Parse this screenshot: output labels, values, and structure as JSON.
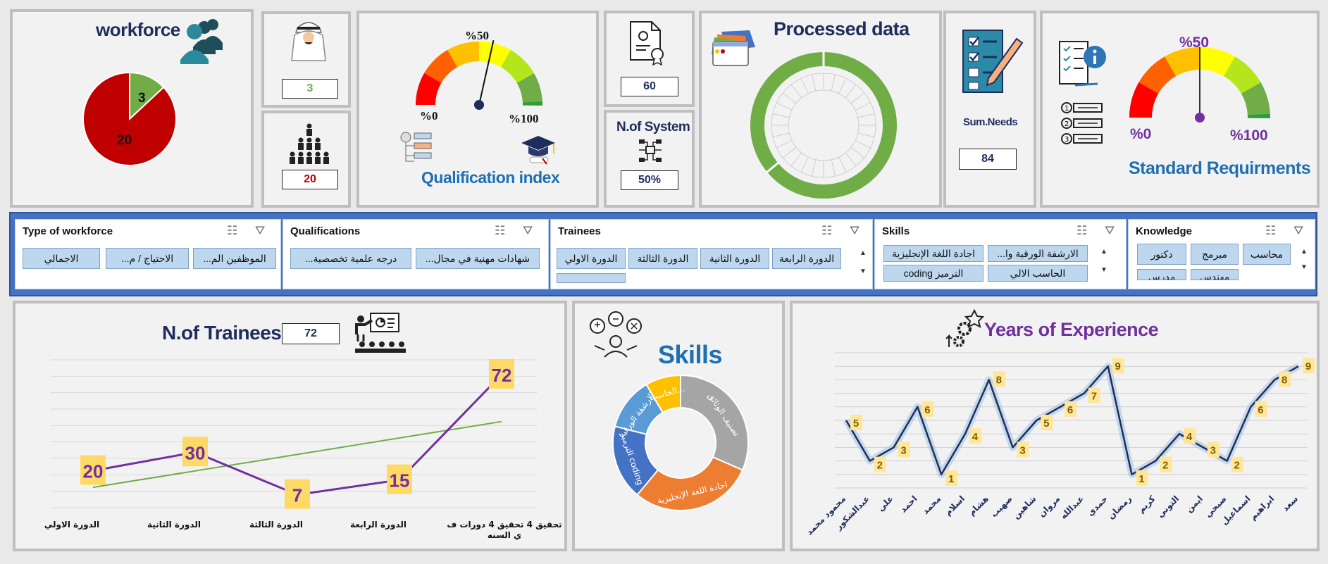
{
  "workforce": {
    "title": "workforce",
    "pie_values": [
      3,
      20
    ],
    "pie_colors": [
      "#70ad47",
      "#c00000"
    ],
    "label_small": "3",
    "label_large": "20"
  },
  "person_count": {
    "value": "3",
    "value_color": "#70ad47"
  },
  "group_count": {
    "value": "20",
    "value_color": "#c00000"
  },
  "qualification_gauge": {
    "title": "Qualification index",
    "label_mid": "%50",
    "label_min": "%0",
    "label_max": "%100",
    "value_percent": 57
  },
  "documents": {
    "value": "60"
  },
  "systems": {
    "title": "N.of System",
    "value": "50%"
  },
  "processed": {
    "title": "Processed data",
    "segments": 28,
    "filled_fraction": 1.0,
    "ring_color": "#70ad47"
  },
  "needs": {
    "title": "Sum.Needs",
    "value": "84"
  },
  "standard_gauge": {
    "title": "Standard Requirments",
    "label_mid": "%50",
    "label_min": "%0",
    "label_max": "%100",
    "value_percent": 50
  },
  "slicers": {
    "workforce": {
      "title": "Type of workforce",
      "items": [
        "الموظفين الم...",
        "الاحتياج / م...",
        "الاجمالي"
      ]
    },
    "qualifications": {
      "title": "Qualifications",
      "items": [
        "شهادات مهنية في مجال...",
        "درجه علمية تخصصية..."
      ]
    },
    "trainees": {
      "title": "Trainees",
      "items": [
        "الدورة الرابعة",
        "الدورة الثانية",
        "الدورة الثالثة",
        "الدورة الاولي"
      ]
    },
    "skills": {
      "title": "Skills",
      "items": [
        "الارشفة الورقية وا...",
        "اجادة اللغة الإنجليزية",
        "الحاسب الالي",
        "الترميز coding"
      ]
    },
    "knowledge": {
      "title": "Knowledge",
      "items": [
        "محاسب",
        "مبرمج",
        "دكتور",
        "مهندس",
        "مدرس"
      ]
    }
  },
  "trainees_chart": {
    "title": "N.of Trainees",
    "total": "72",
    "chart_data": {
      "type": "line",
      "categories": [
        "الدورة الاولي",
        "الدورة الثانية",
        "الدورة الثالثة",
        "الدورة الرابعة",
        "تحقيق 4 تحقيق 4 دورات في السنه"
      ],
      "values": [
        20,
        30,
        7,
        15,
        72
      ],
      "value_labels": [
        "20",
        "30",
        "7",
        "15",
        "72"
      ],
      "trendline": true,
      "series_color": "#7030a0",
      "trend_color": "#70ad47",
      "ylim": [
        0,
        80
      ]
    }
  },
  "skills_chart": {
    "title": "Skills",
    "chart_data": {
      "type": "pie",
      "labels": [
        "تصنيف الوثائق",
        "اجادة اللغة الإنجليزية",
        "الترميز coding",
        "الارشفة الورقية...",
        "الحاسب..."
      ],
      "values": [
        30,
        28,
        17,
        12,
        8
      ],
      "colors": [
        "#a5a5a5",
        "#ed7d31",
        "#4472c4",
        "#5b9bd5",
        "#ffc000"
      ]
    }
  },
  "experience_chart": {
    "title": "Years of Experience",
    "chart_data": {
      "type": "line",
      "categories": [
        "محمود محمد",
        "عبدالشكور",
        "علي",
        "احمد",
        "محمد",
        "اسلام",
        "هشام",
        "صهيب",
        "شاهين",
        "مروان",
        "عبدالله",
        "حمدي",
        "رمضان",
        "كريم",
        "التوني",
        "ايمن",
        "صبحي",
        "اسماعيل",
        "ابراهيم",
        "سعد"
      ],
      "values": [
        5,
        2,
        3,
        6,
        1,
        4,
        8,
        3,
        5,
        6,
        7,
        9,
        1,
        2,
        4,
        3,
        2,
        6,
        8,
        9
      ],
      "series_color": "#1f2d5c",
      "ylim": [
        0,
        10
      ]
    }
  }
}
